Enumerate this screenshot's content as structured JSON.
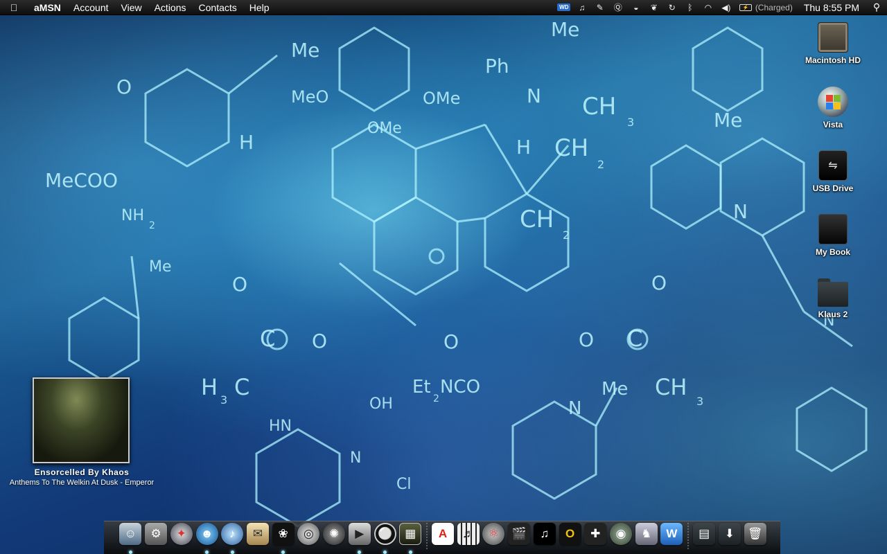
{
  "menubar": {
    "apple_icon": "apple-icon",
    "app_name": "aMSN",
    "menus": [
      "Account",
      "View",
      "Actions",
      "Contacts",
      "Help"
    ],
    "status": {
      "wd_badge": "WD",
      "icons": [
        "itunes-note-icon",
        "guitar-icon",
        "q-icon",
        "menu-meter-icon",
        "paw-icon",
        "time-machine-icon",
        "bluetooth-icon",
        "wifi-icon",
        "volume-icon"
      ],
      "battery_status": "(Charged)",
      "clock": "Thu 8:55 PM"
    }
  },
  "desktop": {
    "icons": [
      {
        "label": "Macintosh HD",
        "icon": "hard-drive-icon"
      },
      {
        "label": "Vista",
        "icon": "windows-logo-icon"
      },
      {
        "label": "USB Drive",
        "icon": "usb-drive-icon"
      },
      {
        "label": "My Book",
        "icon": "external-drive-icon"
      },
      {
        "label": "Klaus 2",
        "icon": "folder-icon"
      }
    ]
  },
  "now_playing": {
    "track": "Ensorcelled By Khaos",
    "album_artist": "Anthems To The Welkin At Dusk - Emperor"
  },
  "wallpaper_labels": [
    "Me",
    "MeO",
    "OMe",
    "OMe",
    "Ph",
    "Me",
    "CH",
    "3",
    "Me",
    "N",
    "O",
    "H",
    "MeCOO",
    "NH",
    "2",
    "Me",
    "H",
    "CH",
    "2",
    "CH",
    "2",
    "N",
    "O",
    "O",
    "C",
    "O",
    "H",
    "3",
    "C",
    "O",
    "C",
    "O",
    "CH",
    "3",
    "Et",
    "2",
    "NCO",
    "N",
    "Me",
    "HN",
    "OH",
    "N",
    "Cl",
    "N"
  ],
  "dock": {
    "items": [
      {
        "name": "finder",
        "glyph": "☺",
        "running": true
      },
      {
        "name": "system-preferences",
        "glyph": "⚙",
        "running": false
      },
      {
        "name": "safari",
        "glyph": "✦",
        "running": false
      },
      {
        "name": "amsn",
        "glyph": "☻",
        "running": true
      },
      {
        "name": "itunes",
        "glyph": "♪",
        "running": true
      },
      {
        "name": "mail",
        "glyph": "✉",
        "running": false
      },
      {
        "name": "adium",
        "glyph": "❀",
        "running": true
      },
      {
        "name": "disc-utility",
        "glyph": "◎",
        "running": false
      },
      {
        "name": "camino",
        "glyph": "✺",
        "running": false
      },
      {
        "name": "quicktime",
        "glyph": "▶",
        "running": true
      },
      {
        "name": "ring-app",
        "glyph": "⚪",
        "running": true
      },
      {
        "name": "photo-viewer",
        "glyph": "▦",
        "running": true
      },
      {
        "name": "adobe",
        "glyph": "A",
        "running": false
      },
      {
        "name": "piano-app",
        "glyph": "♬",
        "running": false
      },
      {
        "name": "molecule-app",
        "glyph": "⚛",
        "running": false
      },
      {
        "name": "clapper-app",
        "glyph": "🎬",
        "running": false
      },
      {
        "name": "music-app",
        "glyph": "♫",
        "running": false
      },
      {
        "name": "office-app",
        "glyph": "O",
        "running": false
      },
      {
        "name": "controller-app",
        "glyph": "✚",
        "running": false
      },
      {
        "name": "gamepad-app",
        "glyph": "◉",
        "running": false
      },
      {
        "name": "robot-app",
        "glyph": "♞",
        "running": false
      },
      {
        "name": "word-app",
        "glyph": "W",
        "running": false
      }
    ],
    "stacks": [
      {
        "name": "documents-stack",
        "glyph": "▤"
      },
      {
        "name": "downloads-stack",
        "glyph": "⬇"
      },
      {
        "name": "trash",
        "glyph": "🗑"
      }
    ]
  },
  "colors": {
    "menubar_bg": "#1a1a1a",
    "wallpaper_glow": "#aef2ff",
    "dock_indicator": "#9fe9ff"
  }
}
